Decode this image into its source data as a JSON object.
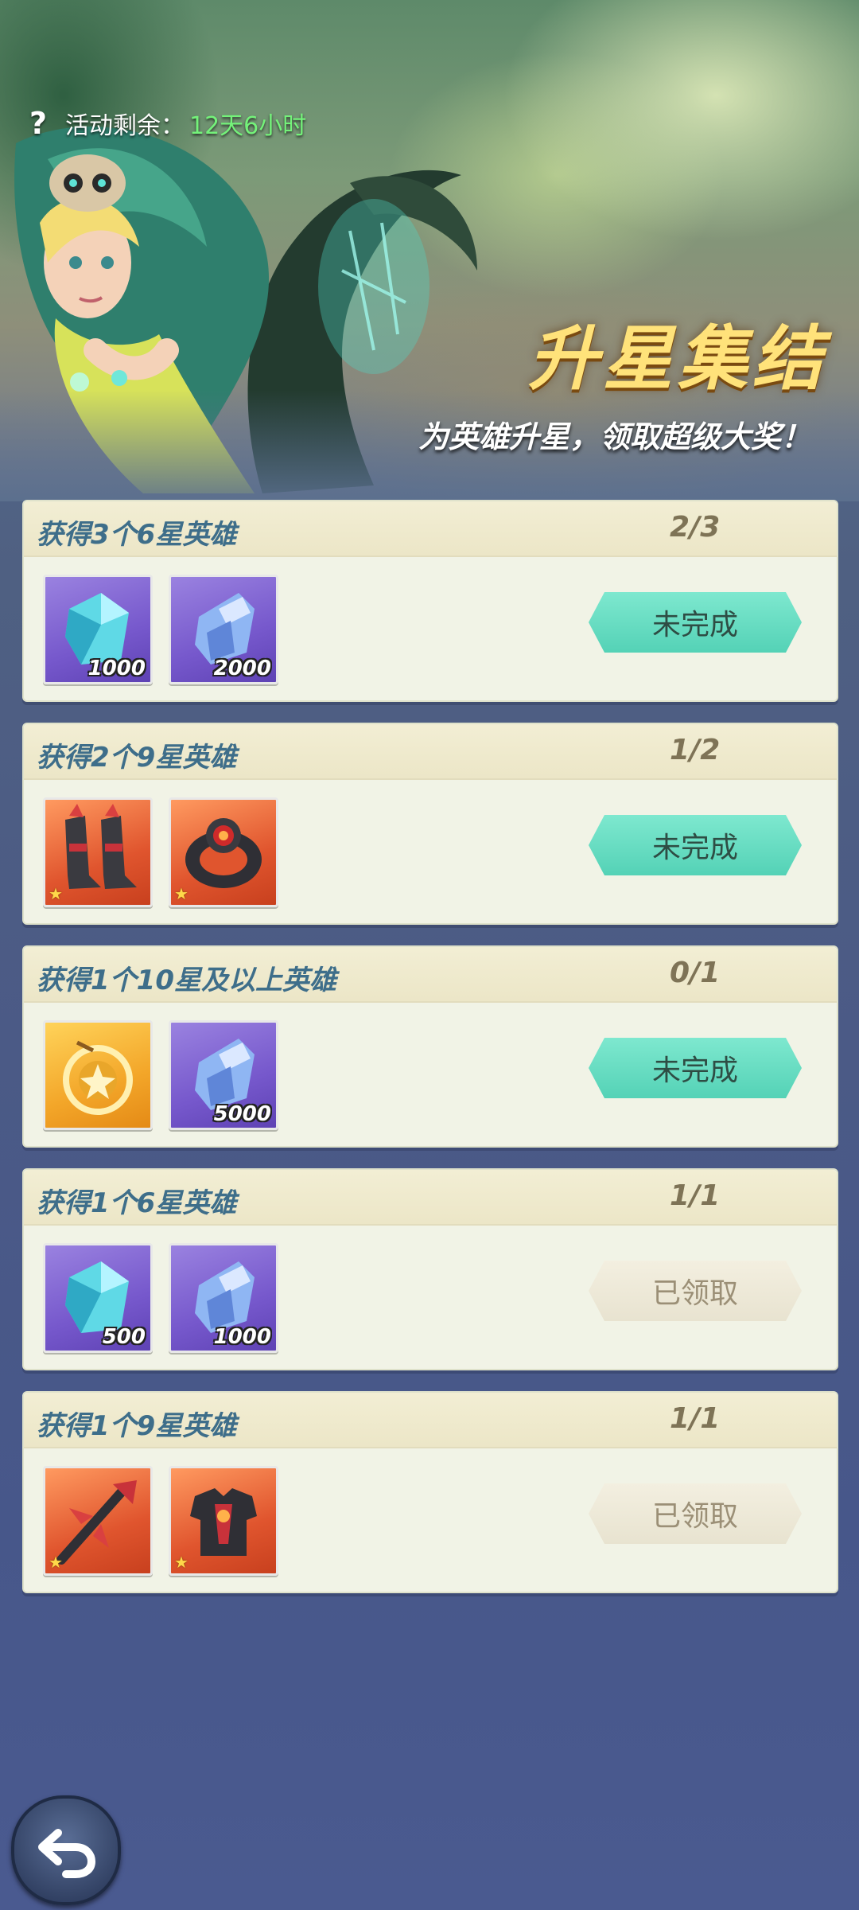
{
  "header": {
    "help_icon": "question-mark-icon",
    "remaining_label": "活动剩余：",
    "remaining_value": "12天6小时",
    "title": "升星集结",
    "subtitle": "为英雄升星，领取超级大奖！"
  },
  "tasks": [
    {
      "title": "获得3个6星英雄",
      "progress": "2/3",
      "status": "未完成",
      "rewards": [
        {
          "icon": "blue-crystal-icon",
          "qty": "1000"
        },
        {
          "icon": "crystal-shard-icon",
          "qty": "2000"
        }
      ]
    },
    {
      "title": "获得2个9星英雄",
      "progress": "1/2",
      "status": "未完成",
      "rewards": [
        {
          "icon": "red-boots-icon",
          "qty": ""
        },
        {
          "icon": "dark-ring-icon",
          "qty": ""
        }
      ]
    },
    {
      "title": "获得1个10星及以上英雄",
      "progress": "0/1",
      "status": "未完成",
      "rewards": [
        {
          "icon": "golden-amulet-icon",
          "qty": ""
        },
        {
          "icon": "crystal-shard-icon",
          "qty": "5000"
        }
      ]
    },
    {
      "title": "获得1个6星英雄",
      "progress": "1/1",
      "status": "已领取",
      "rewards": [
        {
          "icon": "blue-crystal-icon",
          "qty": "500"
        },
        {
          "icon": "crystal-shard-icon",
          "qty": "1000"
        }
      ]
    },
    {
      "title": "获得1个9星英雄",
      "progress": "1/1",
      "status": "已领取",
      "rewards": [
        {
          "icon": "red-weapon-icon",
          "qty": ""
        },
        {
          "icon": "dark-armor-icon",
          "qty": ""
        }
      ]
    }
  ],
  "footer": {
    "back_icon": "back-arrow-icon"
  },
  "colors": {
    "accent_button": "#54d2b6",
    "claimed_button": "#e8e3d0",
    "timer_value": "#74f27a",
    "title": "#ffe27a"
  }
}
